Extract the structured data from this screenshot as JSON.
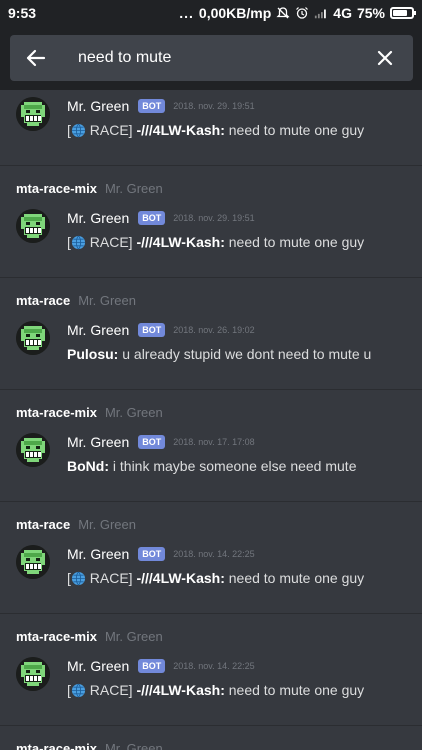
{
  "status_bar": {
    "time": "9:53",
    "dots": "...",
    "net_speed": "0,00KB/mp",
    "network": "4G",
    "battery_pct": "75%",
    "battery_level": 0.75
  },
  "search": {
    "query": "need to mute",
    "back_icon": "arrow-left-icon",
    "clear_icon": "close-icon"
  },
  "colors": {
    "background": "#36393f",
    "header": "#202225",
    "search_field": "#40444b",
    "bot_tag": "#7289da",
    "muted_text": "#72767d"
  },
  "results": [
    {
      "channel": "",
      "server": "",
      "author": "Mr. Green",
      "tag": "BOT",
      "timestamp": "2018. nov. 29. 19:51",
      "prefix": "[",
      "race": " RACE] ",
      "sender": "-///4LW-Kash:",
      "text": " need to mute one guy"
    },
    {
      "channel": "mta-race-mix",
      "server": "Mr. Green",
      "author": "Mr. Green",
      "tag": "BOT",
      "timestamp": "2018. nov. 29. 19:51",
      "prefix": "[",
      "race": " RACE] ",
      "sender": "-///4LW-Kash:",
      "text": " need to mute one guy"
    },
    {
      "channel": "mta-race",
      "server": "Mr. Green",
      "author": "Mr. Green",
      "tag": "BOT",
      "timestamp": "2018. nov. 26. 19:02",
      "sender": "Pulosu:",
      "text": " u already stupid we dont need to mute u"
    },
    {
      "channel": "mta-race-mix",
      "server": "Mr. Green",
      "author": "Mr. Green",
      "tag": "BOT",
      "timestamp": "2018. nov. 17. 17:08",
      "sender": "BoNd:",
      "text": " i think maybe someone else need mute"
    },
    {
      "channel": "mta-race",
      "server": "Mr. Green",
      "author": "Mr. Green",
      "tag": "BOT",
      "timestamp": "2018. nov. 14. 22:25",
      "prefix": "[",
      "race": " RACE] ",
      "sender": "-///4LW-Kash:",
      "text": " need to mute one guy"
    },
    {
      "channel": "mta-race-mix",
      "server": "Mr. Green",
      "author": "Mr. Green",
      "tag": "BOT",
      "timestamp": "2018. nov. 14. 22:25",
      "prefix": "[",
      "race": " RACE] ",
      "sender": "-///4LW-Kash:",
      "text": " need to mute one guy"
    },
    {
      "channel": "mta-race-mix",
      "server": "Mr. Green"
    }
  ]
}
